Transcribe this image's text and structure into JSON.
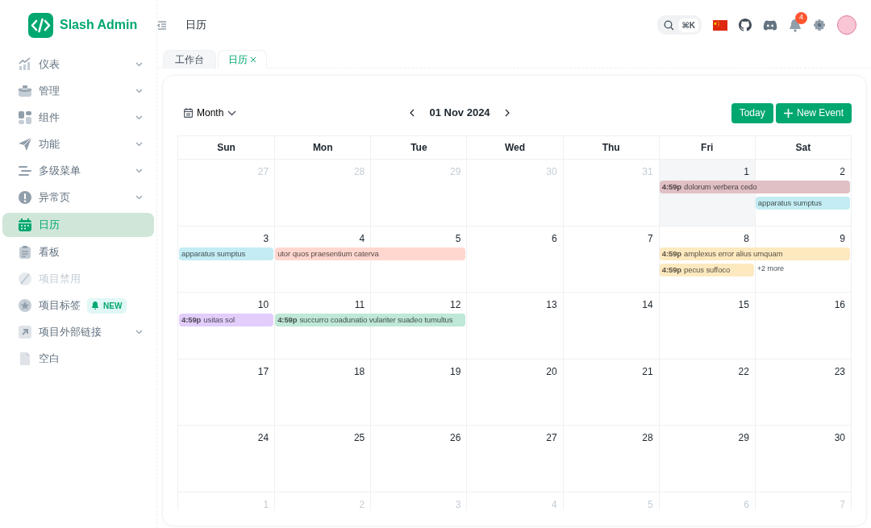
{
  "brand": "Slash Admin",
  "breadcrumb": "日历",
  "search": {
    "shortcut": "⌘K"
  },
  "notifications": {
    "count": "4"
  },
  "sidebar": {
    "items": [
      {
        "label": "仪表",
        "expandable": true,
        "selected": false,
        "disabled": false
      },
      {
        "label": "管理",
        "expandable": true,
        "selected": false,
        "disabled": false
      },
      {
        "label": "组件",
        "expandable": true,
        "selected": false,
        "disabled": false
      },
      {
        "label": "功能",
        "expandable": true,
        "selected": false,
        "disabled": false
      },
      {
        "label": "多级菜单",
        "expandable": true,
        "selected": false,
        "disabled": false
      },
      {
        "label": "异常页",
        "expandable": true,
        "selected": false,
        "disabled": false
      },
      {
        "label": "日历",
        "expandable": false,
        "selected": true,
        "disabled": false
      },
      {
        "label": "看板",
        "expandable": false,
        "selected": false,
        "disabled": false
      },
      {
        "label": "项目禁用",
        "expandable": false,
        "selected": false,
        "disabled": true
      },
      {
        "label": "项目标签",
        "expandable": false,
        "selected": false,
        "disabled": false,
        "badge": "NEW"
      },
      {
        "label": "项目外部链接",
        "expandable": true,
        "selected": false,
        "disabled": false
      },
      {
        "label": "空白",
        "expandable": false,
        "selected": false,
        "disabled": false
      }
    ]
  },
  "tabs": [
    {
      "label": "工作台",
      "selected": false,
      "closable": false
    },
    {
      "label": "日历",
      "selected": true,
      "closable": true
    }
  ],
  "calendar": {
    "view": "Month",
    "date": "01 Nov 2024",
    "buttons": [
      {
        "label": "Today",
        "kind": "plain"
      },
      {
        "label": "New Event",
        "kind": "add"
      }
    ],
    "weekdays": [
      "Sun",
      "Mon",
      "Tue",
      "Wed",
      "Thu",
      "Fri",
      "Sat"
    ],
    "weeks": [
      {
        "days": [
          {
            "label": "27",
            "muted": true
          },
          {
            "label": "28",
            "muted": true
          },
          {
            "label": "29",
            "muted": true
          },
          {
            "label": "30",
            "muted": true
          },
          {
            "label": "31",
            "muted": true
          },
          {
            "label": "1",
            "muted": false,
            "today": true,
            "events": [
              {
                "time": "4:59p",
                "title": "dolorum verbera cedo",
                "continues_next_day": true,
                "color": "#e0c0c4"
              }
            ]
          },
          {
            "label": "2",
            "muted": false,
            "events": [
              {
                "title": "apparatus sumptus",
                "color": "#c3ecf4"
              }
            ]
          }
        ]
      },
      {
        "days": [
          {
            "label": "3",
            "muted": false,
            "events": [
              {
                "title": "apparatus sumptus",
                "continues_next_day": false,
                "color": "#c3ecf4"
              }
            ]
          },
          {
            "label": "4",
            "muted": false,
            "events": [
              {
                "title": "utor quos praesentium caterva",
                "continues_next_day": true,
                "color": "#ffd7cf"
              }
            ]
          },
          {
            "label": "5",
            "muted": false
          },
          {
            "label": "6",
            "muted": false
          },
          {
            "label": "7",
            "muted": false
          },
          {
            "label": "8",
            "muted": false,
            "events": [
              {
                "time": "4:59p",
                "title": "amplexus error alius umquam",
                "continues_next_day": true,
                "color": "#fde9c0"
              },
              {
                "time": "4:59p",
                "title": "pecus suffoco",
                "continues_next_day": false,
                "color": "#fde9c0"
              }
            ]
          },
          {
            "label": "9",
            "muted": false,
            "more": "+2 more"
          }
        ]
      },
      {
        "days": [
          {
            "label": "10",
            "muted": false,
            "events": [
              {
                "time": "4:59p",
                "title": "usitas sol",
                "continues_next_day": false,
                "color": "#e2cdfb"
              }
            ]
          },
          {
            "label": "11",
            "muted": false,
            "events": [
              {
                "time": "4:59p",
                "title": "succurro coadunatio vulariter suadeo tumultus",
                "continues_next_day": true,
                "color": "#bfe8d6"
              }
            ]
          },
          {
            "label": "12",
            "muted": false
          },
          {
            "label": "13",
            "muted": false
          },
          {
            "label": "14",
            "muted": false
          },
          {
            "label": "15",
            "muted": false
          },
          {
            "label": "16",
            "muted": false
          }
        ]
      },
      {
        "days": [
          {
            "label": "17",
            "muted": false
          },
          {
            "label": "18",
            "muted": false
          },
          {
            "label": "19",
            "muted": false
          },
          {
            "label": "20",
            "muted": false
          },
          {
            "label": "21",
            "muted": false
          },
          {
            "label": "22",
            "muted": false
          },
          {
            "label": "23",
            "muted": false
          }
        ]
      },
      {
        "days": [
          {
            "label": "24",
            "muted": false
          },
          {
            "label": "25",
            "muted": false
          },
          {
            "label": "26",
            "muted": false
          },
          {
            "label": "27",
            "muted": false
          },
          {
            "label": "28",
            "muted": false
          },
          {
            "label": "29",
            "muted": false
          },
          {
            "label": "30",
            "muted": false
          }
        ]
      },
      {
        "days": [
          {
            "label": "1",
            "muted": true
          },
          {
            "label": "2",
            "muted": true
          },
          {
            "label": "3",
            "muted": true
          },
          {
            "label": "4",
            "muted": true
          },
          {
            "label": "5",
            "muted": true
          },
          {
            "label": "6",
            "muted": true
          },
          {
            "label": "7",
            "muted": true
          }
        ]
      }
    ]
  }
}
